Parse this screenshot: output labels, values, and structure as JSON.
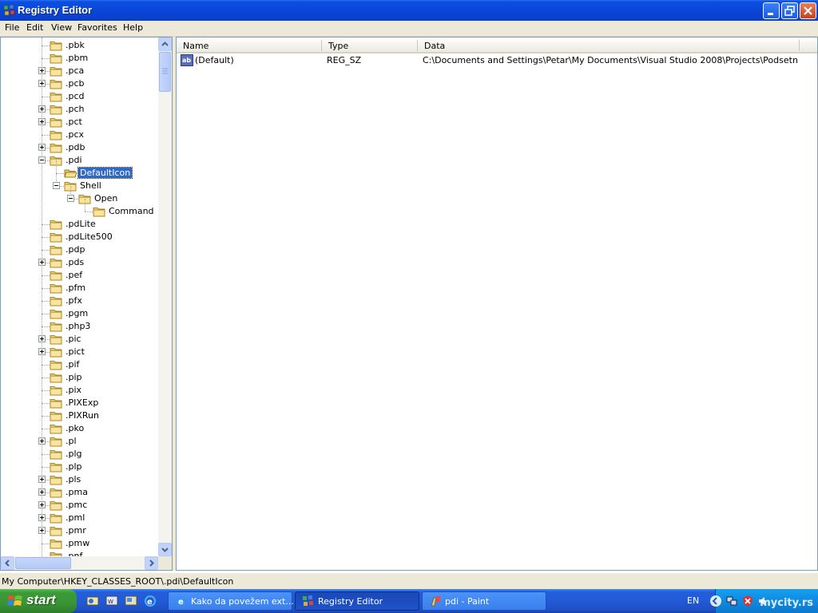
{
  "window": {
    "title": "Registry Editor"
  },
  "menu": [
    "File",
    "Edit",
    "View",
    "Favorites",
    "Help"
  ],
  "tree": {
    "items": [
      {
        "label": ".pbk",
        "expander": "none",
        "level": 0
      },
      {
        "label": ".pbm",
        "expander": "none",
        "level": 0
      },
      {
        "label": ".pca",
        "expander": "plus",
        "level": 0
      },
      {
        "label": ".pcb",
        "expander": "plus",
        "level": 0
      },
      {
        "label": ".pcd",
        "expander": "none",
        "level": 0
      },
      {
        "label": ".pch",
        "expander": "plus",
        "level": 0
      },
      {
        "label": ".pct",
        "expander": "plus",
        "level": 0
      },
      {
        "label": ".pcx",
        "expander": "none",
        "level": 0
      },
      {
        "label": ".pdb",
        "expander": "plus",
        "level": 0
      },
      {
        "label": ".pdi",
        "expander": "minus",
        "level": 0
      },
      {
        "label": "DefaultIcon",
        "expander": "none",
        "level": 1,
        "selected": true,
        "open": true
      },
      {
        "label": "Shell",
        "expander": "minus",
        "level": 1
      },
      {
        "label": "Open",
        "expander": "minus",
        "level": 2
      },
      {
        "label": "Command",
        "expander": "none",
        "level": 3
      },
      {
        "label": ".pdLite",
        "expander": "none",
        "level": 0
      },
      {
        "label": ".pdLite500",
        "expander": "none",
        "level": 0
      },
      {
        "label": ".pdp",
        "expander": "none",
        "level": 0
      },
      {
        "label": ".pds",
        "expander": "plus",
        "level": 0
      },
      {
        "label": ".pef",
        "expander": "none",
        "level": 0
      },
      {
        "label": ".pfm",
        "expander": "none",
        "level": 0
      },
      {
        "label": ".pfx",
        "expander": "none",
        "level": 0
      },
      {
        "label": ".pgm",
        "expander": "none",
        "level": 0
      },
      {
        "label": ".php3",
        "expander": "none",
        "level": 0
      },
      {
        "label": ".pic",
        "expander": "plus",
        "level": 0
      },
      {
        "label": ".pict",
        "expander": "plus",
        "level": 0
      },
      {
        "label": ".pif",
        "expander": "none",
        "level": 0
      },
      {
        "label": ".pip",
        "expander": "none",
        "level": 0
      },
      {
        "label": ".pix",
        "expander": "none",
        "level": 0
      },
      {
        "label": ".PIXExp",
        "expander": "none",
        "level": 0
      },
      {
        "label": ".PIXRun",
        "expander": "none",
        "level": 0
      },
      {
        "label": ".pko",
        "expander": "none",
        "level": 0
      },
      {
        "label": ".pl",
        "expander": "plus",
        "level": 0
      },
      {
        "label": ".plg",
        "expander": "none",
        "level": 0
      },
      {
        "label": ".plp",
        "expander": "none",
        "level": 0
      },
      {
        "label": ".pls",
        "expander": "plus",
        "level": 0
      },
      {
        "label": ".pma",
        "expander": "plus",
        "level": 0
      },
      {
        "label": ".pmc",
        "expander": "plus",
        "level": 0
      },
      {
        "label": ".pml",
        "expander": "plus",
        "level": 0
      },
      {
        "label": ".pmr",
        "expander": "plus",
        "level": 0
      },
      {
        "label": ".pmw",
        "expander": "none",
        "level": 0
      },
      {
        "label": ".pnf",
        "expander": "none",
        "level": 0
      }
    ]
  },
  "list": {
    "columns": [
      "Name",
      "Type",
      "Data"
    ],
    "rows": [
      {
        "icon": "string-value-icon",
        "name": "(Default)",
        "type": "REG_SZ",
        "data": "C:\\Documents and Settings\\Petar\\My Documents\\Visual Studio 2008\\Projects\\Podsetnik\\Podse..."
      }
    ]
  },
  "status": {
    "path": "My Computer\\HKEY_CLASSES_ROOT\\.pdi\\DefaultIcon"
  },
  "taskbar": {
    "start_label": "start",
    "tasks": [
      {
        "label": "Kako da povežem ext...",
        "icon": "ie-icon",
        "active": false
      },
      {
        "label": "Registry Editor",
        "icon": "regedit-icon",
        "active": true
      },
      {
        "label": "pdi - Paint",
        "icon": "paint-icon",
        "active": false
      }
    ],
    "language": "EN",
    "watermark": "mycity.rs"
  },
  "colors": {
    "titlebar": "#0a46d8",
    "selection": "#316ac5",
    "chrome": "#ece9d8",
    "start_green": "#3a9435"
  }
}
